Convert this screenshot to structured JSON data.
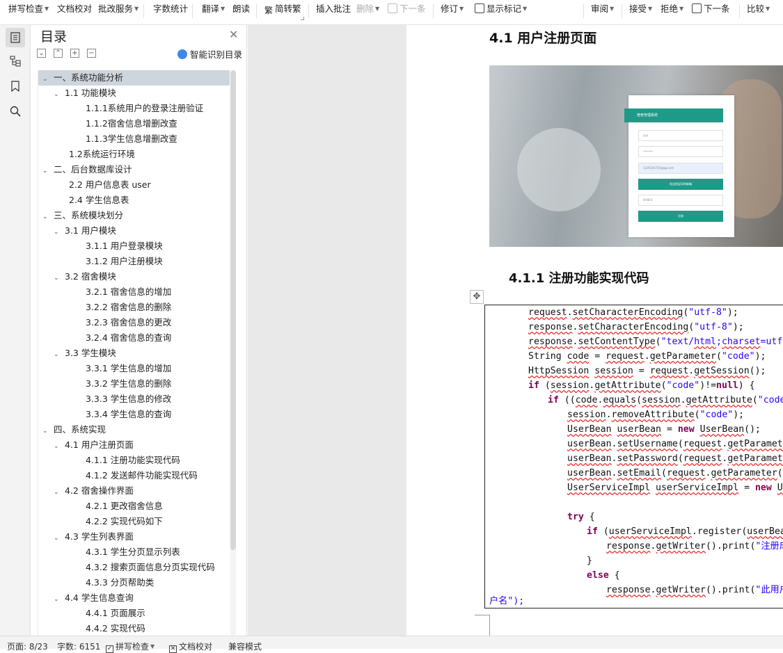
{
  "toolbar": {
    "items": [
      "拼写检查",
      "文档校对",
      "批改服务",
      "字数统计",
      "翻译",
      "朗读",
      "简转繁",
      "插入批注",
      "删除",
      "下一条",
      "修订",
      "显示标记",
      "审阅",
      "接受",
      "拒绝",
      "下一条",
      "比较"
    ]
  },
  "toc": {
    "title": "目录",
    "smart_label": "智能识别目录",
    "items": [
      "一、系统功能分析",
      "1.1  功能模块",
      "1.1.1系统用户的登录注册验证",
      "1.1.2宿舍信息增删改查",
      "1.1.3学生信息增删改查",
      "1.2系统运行环境",
      "二、后台数据库设计",
      "2.2  用户信息表 user",
      "2.4 学生信息表",
      "三、系统模块划分",
      "3.1  用户模块",
      "3.1.1  用户登录模块",
      "3.1.2 用户注册模块",
      "3.2  宿舍模块",
      "3.2.1  宿舍信息的增加",
      "3.2.2  宿舍信息的删除",
      "3.2.3  宿舍信息的更改",
      "3.2.4  宿舍信息的查询",
      "3.3 学生模块",
      "3.3.1 学生信息的增加",
      "3.3.2 学生信息的删除",
      "3.3.3 学生信息的修改",
      "3.3.4 学生信息的查询",
      "四、系统实现",
      "4.1 用户注册页面",
      "4.1.1 注册功能实现代码",
      "4.1.2 发送邮件功能实现代码",
      "4.2 宿舍操作界面",
      "4.2.1 更改宿舍信息",
      "4.2.2 实现代码如下",
      "4.3 学生列表界面",
      "4.3.1  学生分页显示列表",
      "4.3.2 搜索页面信息分页实现代码",
      "4.3.3 分页帮助类",
      "4.4 学生信息查询",
      "4.4.1 页面展示",
      "4.4.2 实现代码"
    ]
  },
  "doc": {
    "heading_41": "4.1 用户注册页面",
    "heading_411": "4.1.1 注册功能实现代码",
    "screenshot": {
      "card_title": "宿舍管理系统",
      "field1": "yyy",
      "field2": "••••••",
      "field3": "1226164710@qq.com",
      "button1": "发送验证码到邮箱",
      "field4": "0r00r3",
      "button2": "注册"
    },
    "code_tail": "户名\");"
  },
  "status": {
    "page": "页面: 8/23",
    "words": "字数: 6151",
    "spell": "拼写检查",
    "proof": "文档校对",
    "compat": "兼容模式"
  },
  "colors": {
    "accent": "#1f9a88",
    "selected": "#cfd5dc",
    "keyword": "#7f0055",
    "string": "#2a00ff"
  }
}
